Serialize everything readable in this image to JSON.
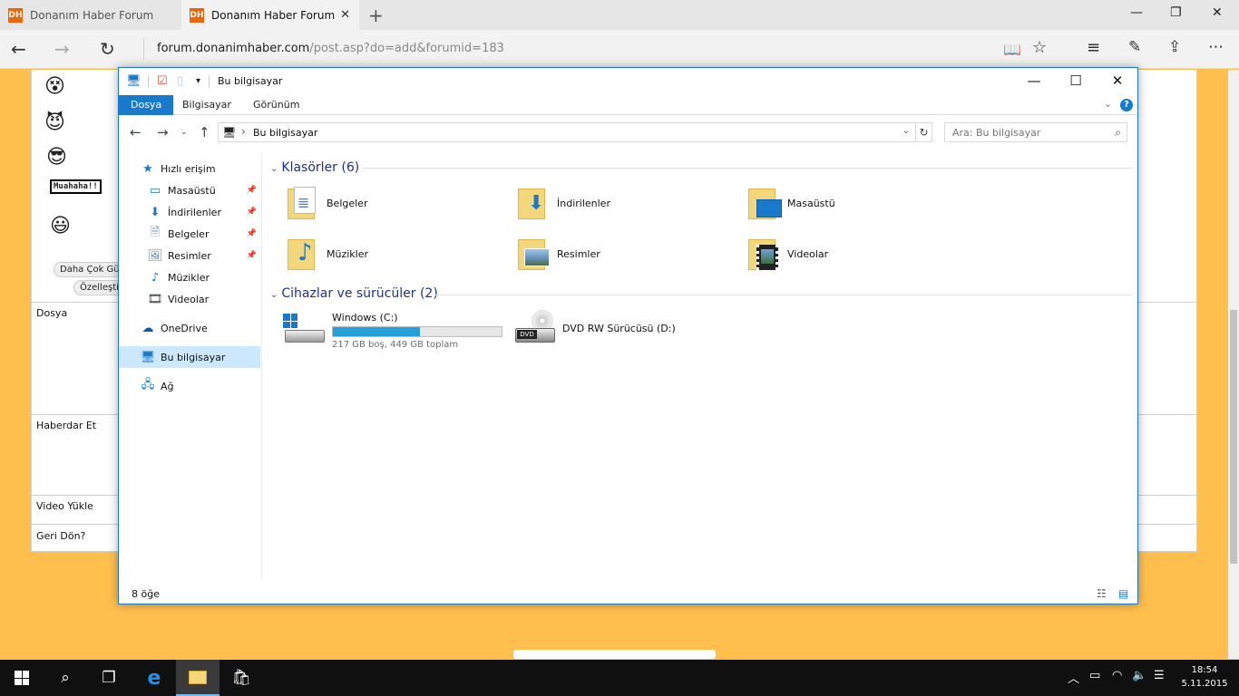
{
  "browser": {
    "tabs": [
      {
        "label": "Donanım Haber Forum",
        "favicon": "DH",
        "active": false
      },
      {
        "label": "Donanım Haber Forum",
        "favicon": "DH",
        "active": true
      }
    ],
    "address_host": "forum.donanimhaber.com",
    "address_path": "/post.asp?do=add&forumid=183"
  },
  "page": {
    "muahaha": "Muahaha!!",
    "more_smileys_btn": "Daha Çok Gü",
    "customize_btn": "Özelleştir",
    "rows": [
      "Dosya",
      "Haberdar Et",
      "Video Yükle",
      "Geri Dön?"
    ]
  },
  "explorer": {
    "title": "Bu bilgisayar",
    "ribbon_tabs": [
      "Dosya",
      "Bilgisayar",
      "Görünüm"
    ],
    "help": "?",
    "path": "Bu bilgisayar",
    "search_placeholder": "Ara: Bu bilgisayar",
    "nav": {
      "quick_access": "Hızlı erişim",
      "pinned": [
        "Masaüstü",
        "İndirilenler",
        "Belgeler",
        "Resimler"
      ],
      "others": [
        "Müzikler",
        "Videolar"
      ],
      "onedrive": "OneDrive",
      "this_pc": "Bu bilgisayar",
      "network": "Ağ"
    },
    "folders_header": "Klasörler (6)",
    "folders": [
      "Belgeler",
      "İndirilenler",
      "Masaüstü",
      "Müzikler",
      "Resimler",
      "Videolar"
    ],
    "devices_header": "Cihazlar ve sürücüler (2)",
    "drives": [
      {
        "name": "Windows (C:)",
        "sub": "217 GB boş, 449 GB toplam",
        "used_fraction": 0.517
      },
      {
        "name": "DVD RW Sürücüsü (D:)"
      }
    ],
    "status": "8 öğe",
    "accent": "#1979ca"
  },
  "taskbar": {
    "time": "18:54",
    "date": "5.11.2015"
  }
}
